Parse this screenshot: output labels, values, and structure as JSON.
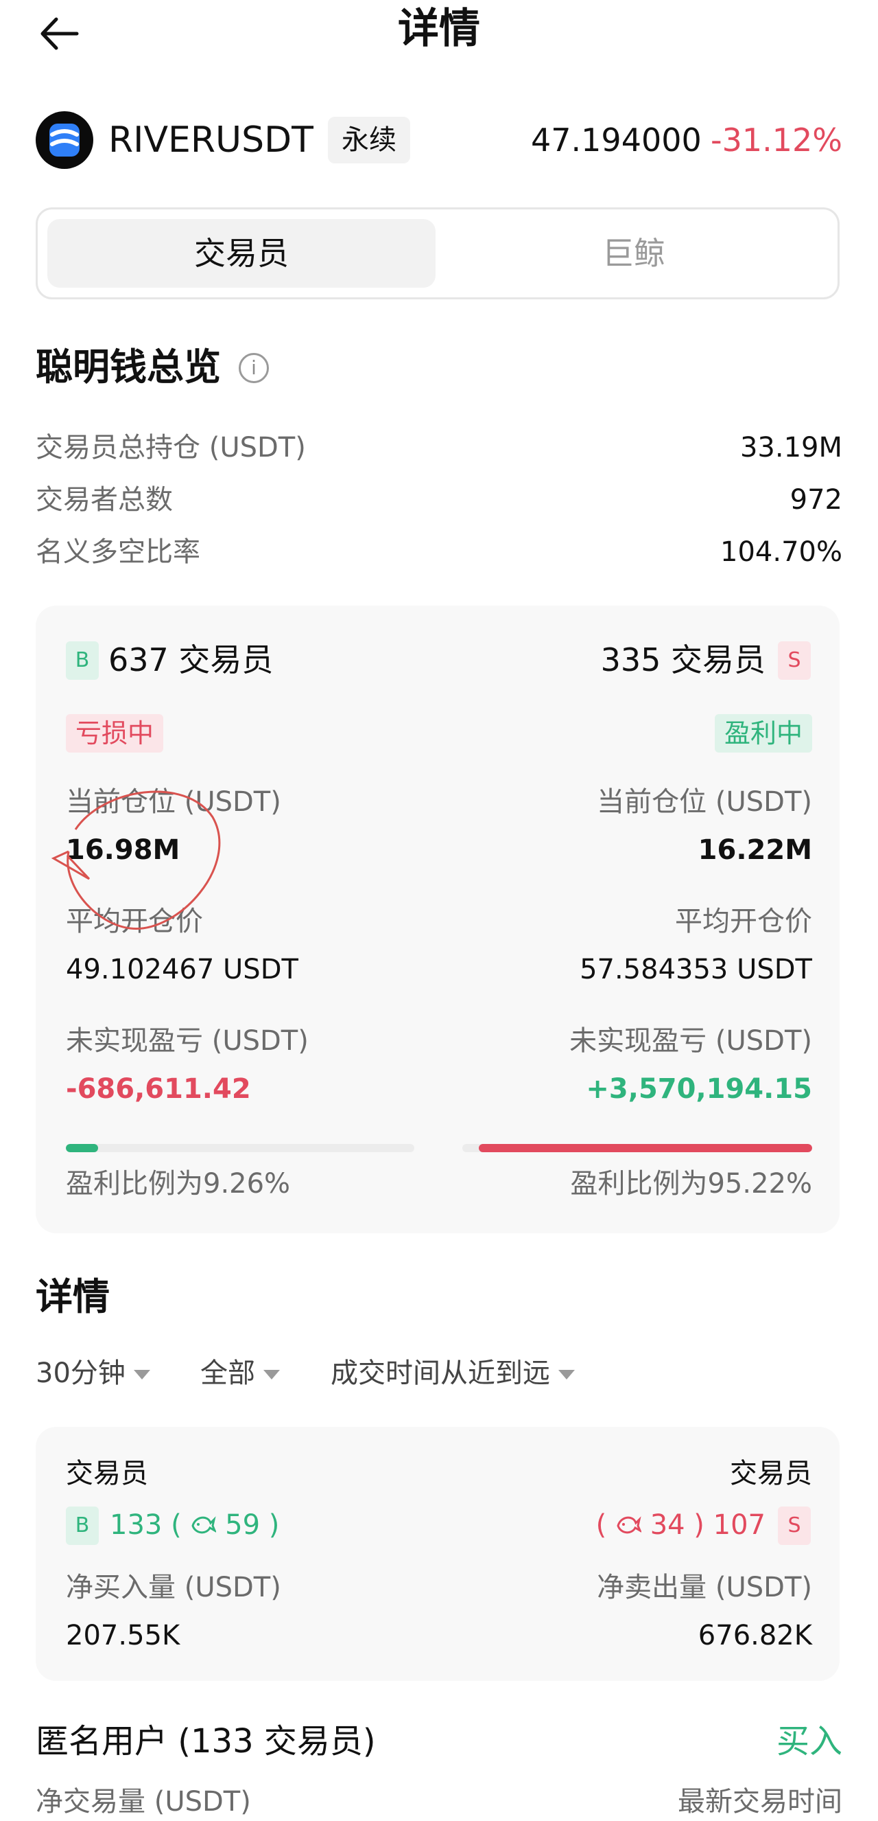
{
  "header": {
    "title": "详情",
    "back_icon": "arrow-left-icon"
  },
  "ticker": {
    "symbol": "RIVERUSDT",
    "badge": "永续",
    "price": "47.194000",
    "change": "-31.12%",
    "logo_icon": "river-logo-icon"
  },
  "tabs": [
    {
      "label": "交易员",
      "active": true
    },
    {
      "label": "巨鲸",
      "active": false
    }
  ],
  "overview": {
    "title": "聪明钱总览",
    "rows": [
      {
        "label": "交易员总持仓 (USDT)",
        "value": "33.19M"
      },
      {
        "label": "交易者总数",
        "value": "972"
      },
      {
        "label": "名义多空比率",
        "value": "104.70%"
      }
    ]
  },
  "long_side": {
    "tag": "B",
    "count_label": "637 交易员",
    "status": "亏损中",
    "position_label": "当前仓位 (USDT)",
    "position_value": "16.98M",
    "avg_label": "平均开仓价",
    "avg_value": "49.102467 USDT",
    "pnl_label": "未实现盈亏 (USDT)",
    "pnl_value": "-686,611.42",
    "profit_ratio": 0.0926,
    "profit_ratio_text": "盈利比例为9.26%"
  },
  "short_side": {
    "tag": "S",
    "count_label": "335 交易员",
    "status": "盈利中",
    "position_label": "当前仓位 (USDT)",
    "position_value": "16.22M",
    "avg_label": "平均开仓价",
    "avg_value": "57.584353 USDT",
    "pnl_label": "未实现盈亏 (USDT)",
    "pnl_value": "+3,570,194.15",
    "profit_ratio": 0.9522,
    "profit_ratio_text": "盈利比例为95.22%"
  },
  "details": {
    "title": "详情",
    "filters": [
      "30分钟",
      "全部",
      "成交时间从近到远"
    ],
    "card": {
      "left_title": "交易员",
      "right_title": "交易员",
      "buy_tag": "B",
      "sell_tag": "S",
      "buy_count": "133",
      "buy_whale": "59",
      "sell_whale": "34",
      "sell_count": "107",
      "net_buy_label": "净买入量 (USDT)",
      "net_buy_value": "207.55K",
      "net_sell_label": "净卖出量 (USDT)",
      "net_sell_value": "676.82K"
    }
  },
  "anon": {
    "title": "匿名用户 (133 交易员)",
    "action": "买入",
    "col_left": "净交易量 (USDT)",
    "col_right": "最新交易时间"
  },
  "colors": {
    "green": "#2fb47d",
    "red": "#e24a5e",
    "annotation": "#d9534f"
  }
}
